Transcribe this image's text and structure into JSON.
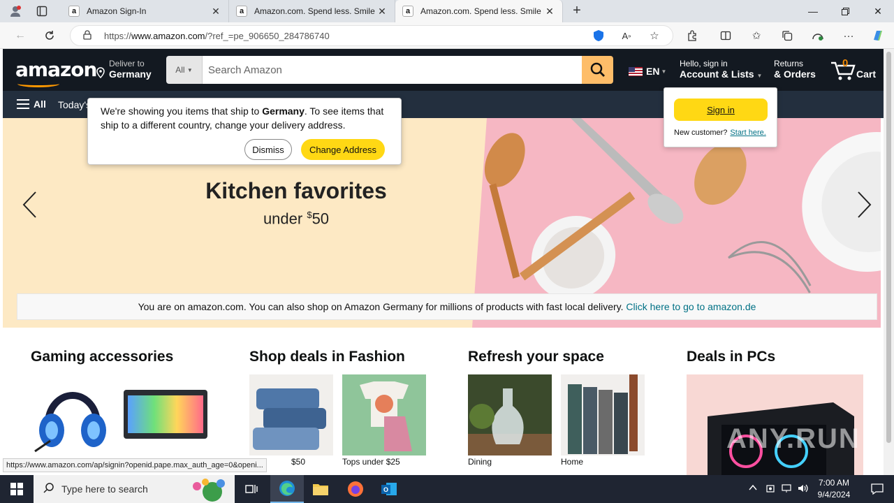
{
  "browser": {
    "tabs": [
      {
        "title": "Amazon Sign-In",
        "active": false
      },
      {
        "title": "Amazon.com. Spend less. Smile m",
        "active": false
      },
      {
        "title": "Amazon.com. Spend less. Smile m",
        "active": true
      }
    ],
    "url_prefix": "https://",
    "url_host": "www.amazon.com",
    "url_rest": "/?ref_=pe_906650_284786740",
    "status_url": "https://www.amazon.com/ap/signin?openid.pape.max_auth_age=0&openi..."
  },
  "amazon": {
    "logo": "amazon",
    "deliver": {
      "line1": "Deliver to",
      "line2": "Germany"
    },
    "search": {
      "category": "All",
      "placeholder": "Search Amazon"
    },
    "lang": "EN",
    "account": {
      "line1": "Hello, sign in",
      "line2": "Account & Lists"
    },
    "orders": {
      "line1": "Returns",
      "line2": "& Orders"
    },
    "cart": {
      "count": "0",
      "label": "Cart"
    },
    "nav": {
      "all": "All",
      "todays": "Today's"
    },
    "popover": {
      "msg_pre": "We're showing you items that ship to ",
      "msg_bold": "Germany",
      "msg_post": ". To see items that ship to a different country, change your delivery address.",
      "dismiss": "Dismiss",
      "change": "Change Address"
    },
    "signin_popover": {
      "button": "Sign in",
      "new_customer": "New customer?",
      "start_here": "Start here."
    },
    "hero": {
      "title": "Kitchen favorites",
      "sub_pre": "under ",
      "sub_sup": "$",
      "sub_val": "50"
    },
    "germany_bar": {
      "text": "You are on amazon.com. You can also shop on Amazon Germany for millions of products with fast local delivery. ",
      "link": "Click here to go to amazon.de"
    },
    "cards": [
      {
        "title": "Gaming accessories",
        "items": [
          "",
          ""
        ]
      },
      {
        "title": "Shop deals in Fashion",
        "items": [
          "$50",
          "Tops under $25"
        ]
      },
      {
        "title": "Refresh your space",
        "items": [
          "Dining",
          "Home"
        ]
      },
      {
        "title": "Deals in PCs",
        "items": []
      }
    ]
  },
  "taskbar": {
    "search_placeholder": "Type here to search",
    "time": "7:00 AM",
    "date": "9/4/2024"
  },
  "watermark": "ANY.RUN",
  "colors": {
    "amazon_dark": "#131921",
    "amazon_nav": "#232f3e",
    "accent": "#febd69",
    "button_yellow": "#ffd814",
    "link": "#007185"
  }
}
